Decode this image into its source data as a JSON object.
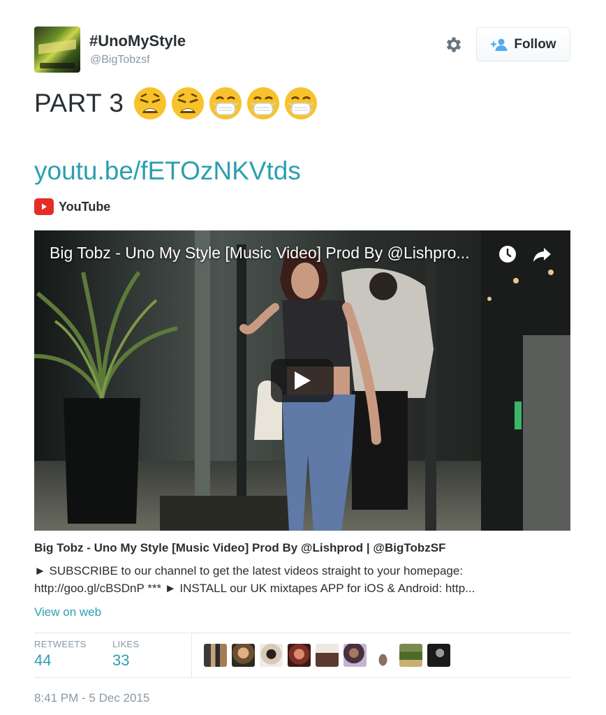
{
  "header": {
    "display_name": "#UnoMyStyle",
    "handle": "@BigTobzsf",
    "follow_label": "Follow"
  },
  "tweet": {
    "text": "PART 3",
    "emojis": [
      "weary-face-emoji",
      "weary-face-emoji",
      "face-with-medical-mask-emoji",
      "face-with-medical-mask-emoji",
      "face-with-medical-mask-emoji"
    ],
    "link": "youtu.be/fETOzNKVtds"
  },
  "card": {
    "source": "YouTube",
    "video_title": "Big Tobz - Uno My Style [Music Video] Prod By @Lishpro...",
    "title": "Big Tobz - Uno My Style [Music Video] Prod By @Lishprod | @BigTobzSF",
    "description_line1": "► SUBSCRIBE to our channel to get the latest videos straight to your homepage:",
    "description_line2": "http://goo.gl/cBSDnP *** ► INSTALL our UK mixtapes APP for iOS & Android: http...",
    "view_on_web": "View on web"
  },
  "stats": {
    "retweets_label": "RETWEETS",
    "retweets_count": "44",
    "likes_label": "LIKES",
    "likes_count": "33"
  },
  "timestamp": "8:41 PM - 5 Dec 2015",
  "colors": {
    "link": "#2b9fb0",
    "text": "#292f33",
    "muted": "#8899a6",
    "youtube_red": "#e52d27",
    "emoji_yellow": "#f7c22b"
  }
}
